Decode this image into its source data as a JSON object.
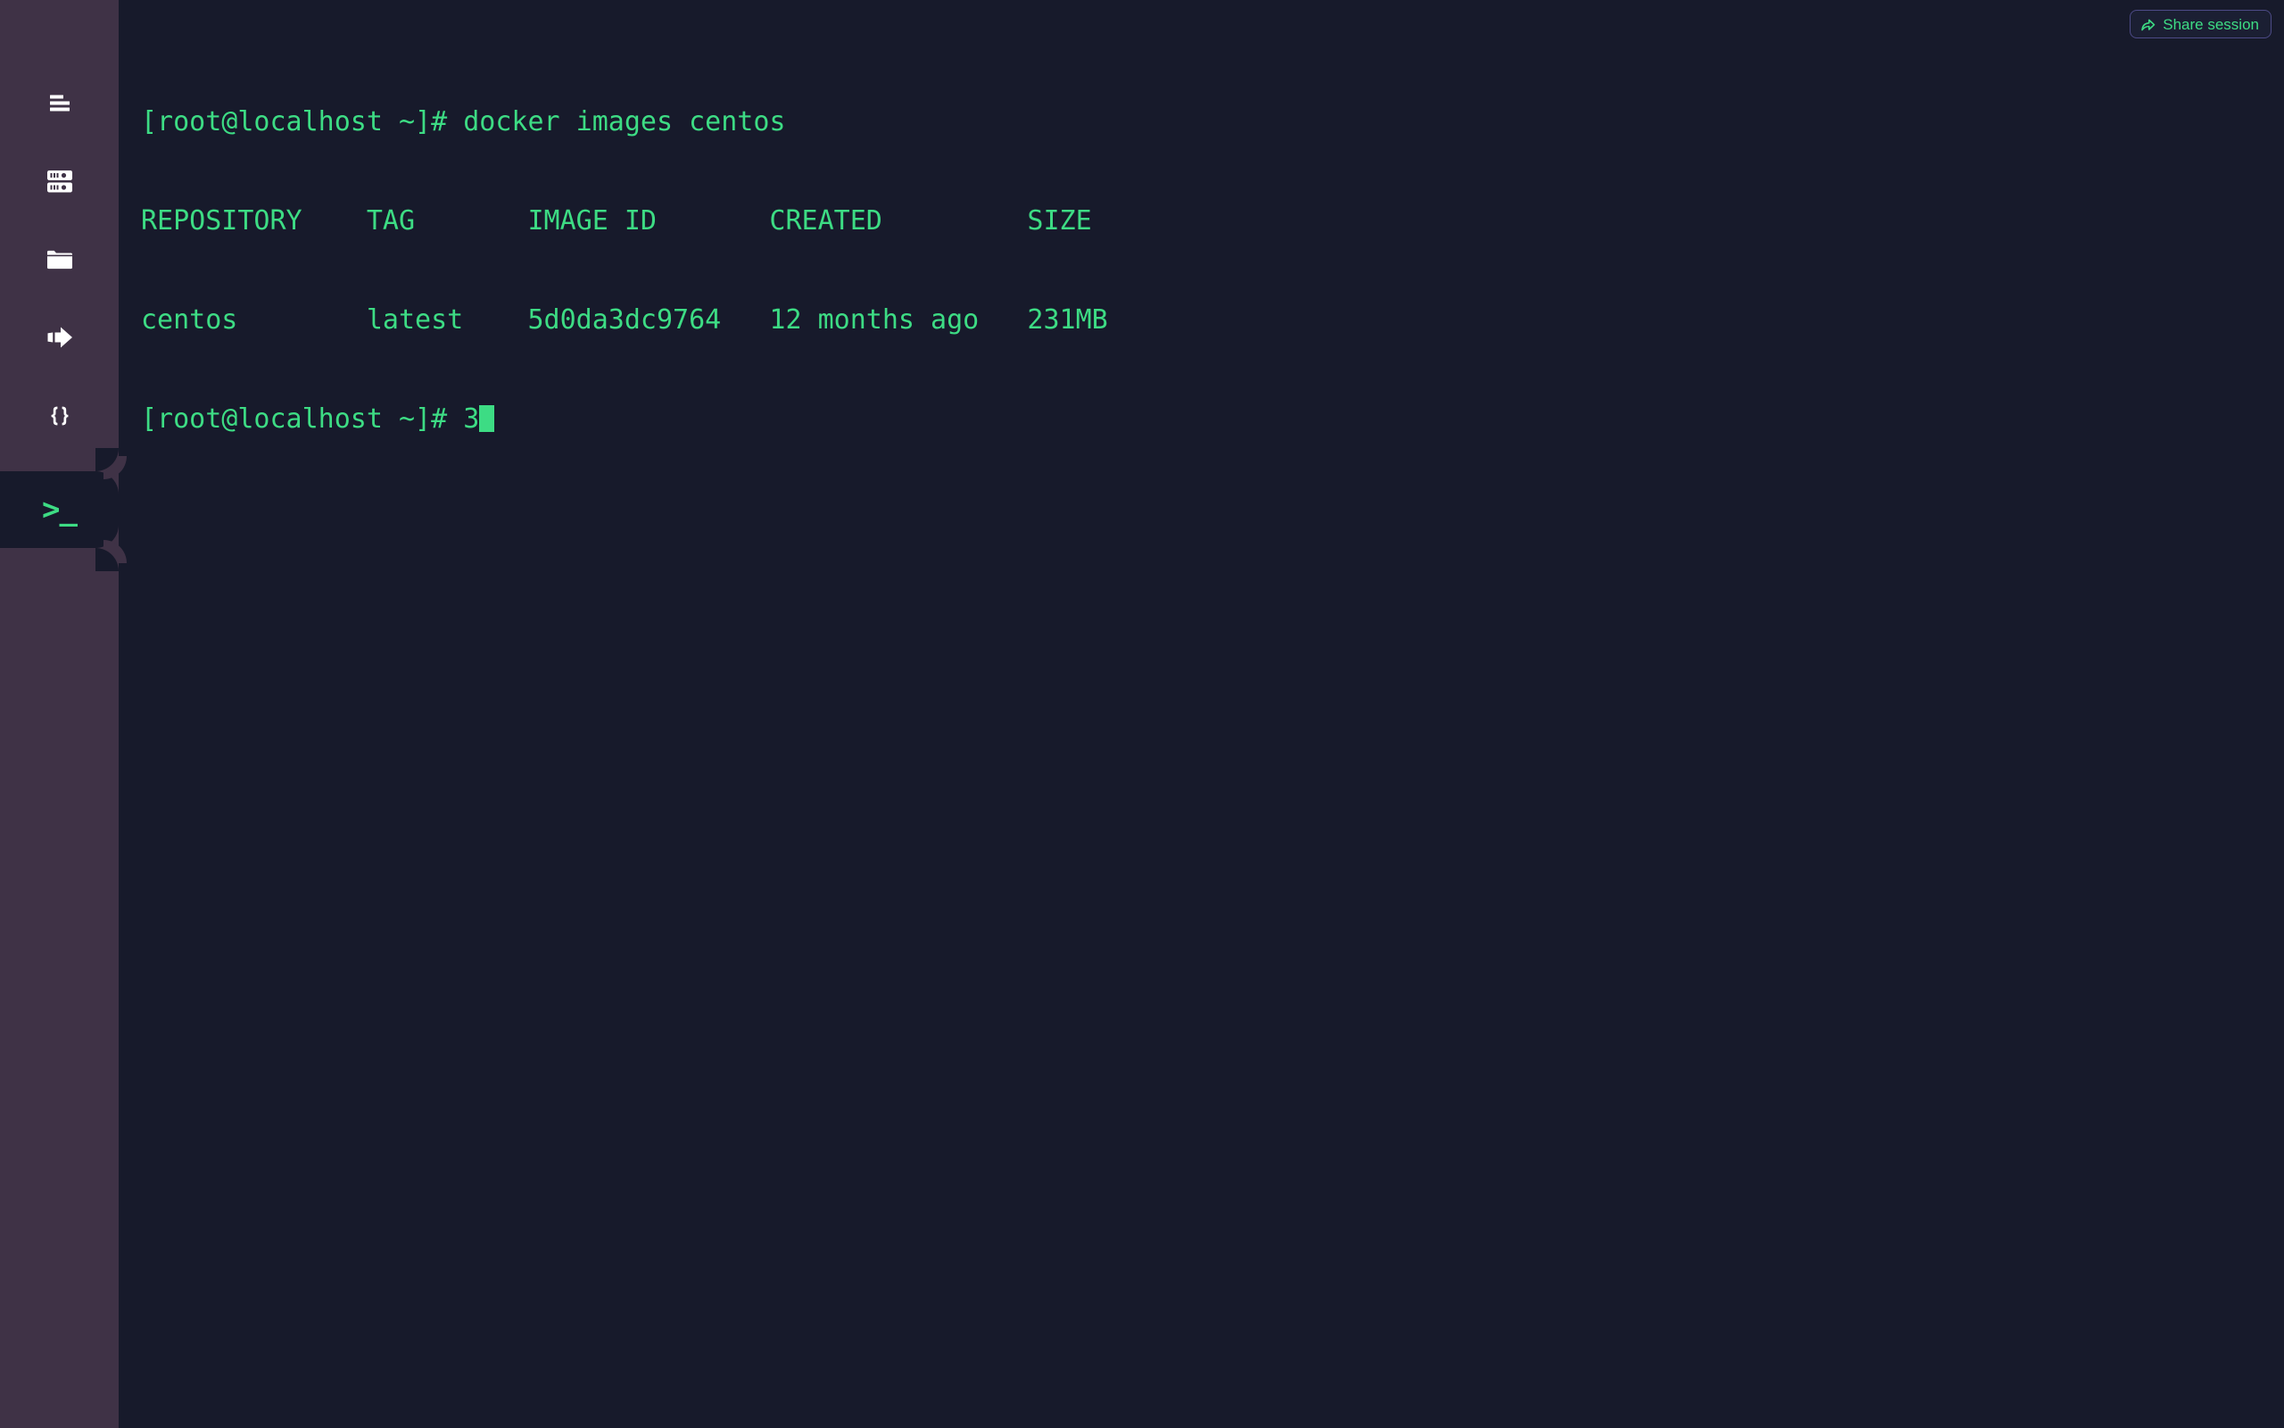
{
  "theme": {
    "sidebar_bg": "#3f3246",
    "terminal_bg": "#171a2b",
    "terminal_fg": "#3ddc84",
    "icon_color": "#ffffff",
    "accent_border": "#4c4a86",
    "button_bg": "#1b1f33"
  },
  "sidebar": {
    "items": [
      {
        "id": "menu",
        "icon": "hamburger-menu-icon",
        "active": false
      },
      {
        "id": "servers",
        "icon": "server-rack-icon",
        "active": false
      },
      {
        "id": "files",
        "icon": "folder-icon",
        "active": false
      },
      {
        "id": "forward",
        "icon": "forward-arrow-icon",
        "active": false
      },
      {
        "id": "code",
        "icon": "curly-braces-icon",
        "active": false
      },
      {
        "id": "terminal",
        "icon": "terminal-prompt-icon",
        "active": true,
        "glyph": ">_"
      }
    ]
  },
  "share_button": {
    "label": "Share session",
    "icon": "share-arrow-icon"
  },
  "terminal": {
    "prompt": "[root@localhost ~]#",
    "lines": [
      {
        "type": "command",
        "text": "[root@localhost ~]# docker images centos"
      },
      {
        "type": "header",
        "text": "REPOSITORY    TAG       IMAGE ID       CREATED         SIZE"
      },
      {
        "type": "row",
        "text": "centos        latest    5d0da3dc9764   12 months ago   231MB"
      },
      {
        "type": "input",
        "text": "[root@localhost ~]# 3"
      }
    ],
    "table": {
      "columns": [
        "REPOSITORY",
        "TAG",
        "IMAGE ID",
        "CREATED",
        "SIZE"
      ],
      "rows": [
        [
          "centos",
          "latest",
          "5d0da3dc9764",
          "12 months ago",
          "231MB"
        ]
      ]
    },
    "current_input": "3",
    "cursor_visible": true
  }
}
